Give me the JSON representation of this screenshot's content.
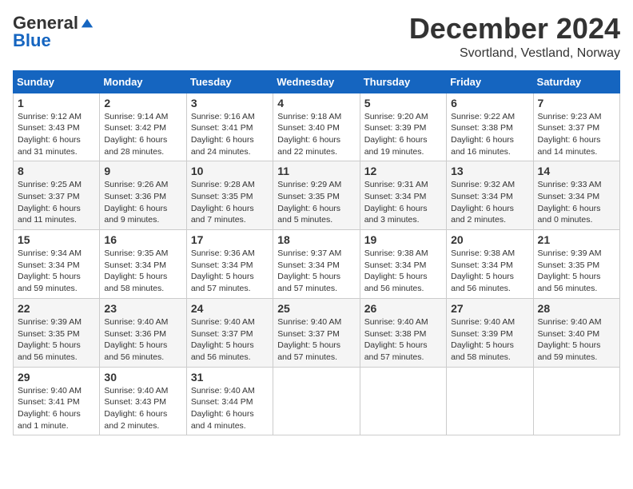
{
  "header": {
    "logo_general": "General",
    "logo_blue": "Blue",
    "month_title": "December 2024",
    "location": "Svortland, Vestland, Norway"
  },
  "days_of_week": [
    "Sunday",
    "Monday",
    "Tuesday",
    "Wednesday",
    "Thursday",
    "Friday",
    "Saturday"
  ],
  "weeks": [
    [
      {
        "day": "1",
        "sunrise": "9:12 AM",
        "sunset": "3:43 PM",
        "daylight": "6 hours and 31 minutes."
      },
      {
        "day": "2",
        "sunrise": "9:14 AM",
        "sunset": "3:42 PM",
        "daylight": "6 hours and 28 minutes."
      },
      {
        "day": "3",
        "sunrise": "9:16 AM",
        "sunset": "3:41 PM",
        "daylight": "6 hours and 24 minutes."
      },
      {
        "day": "4",
        "sunrise": "9:18 AM",
        "sunset": "3:40 PM",
        "daylight": "6 hours and 22 minutes."
      },
      {
        "day": "5",
        "sunrise": "9:20 AM",
        "sunset": "3:39 PM",
        "daylight": "6 hours and 19 minutes."
      },
      {
        "day": "6",
        "sunrise": "9:22 AM",
        "sunset": "3:38 PM",
        "daylight": "6 hours and 16 minutes."
      },
      {
        "day": "7",
        "sunrise": "9:23 AM",
        "sunset": "3:37 PM",
        "daylight": "6 hours and 14 minutes."
      }
    ],
    [
      {
        "day": "8",
        "sunrise": "9:25 AM",
        "sunset": "3:37 PM",
        "daylight": "6 hours and 11 minutes."
      },
      {
        "day": "9",
        "sunrise": "9:26 AM",
        "sunset": "3:36 PM",
        "daylight": "6 hours and 9 minutes."
      },
      {
        "day": "10",
        "sunrise": "9:28 AM",
        "sunset": "3:35 PM",
        "daylight": "6 hours and 7 minutes."
      },
      {
        "day": "11",
        "sunrise": "9:29 AM",
        "sunset": "3:35 PM",
        "daylight": "6 hours and 5 minutes."
      },
      {
        "day": "12",
        "sunrise": "9:31 AM",
        "sunset": "3:34 PM",
        "daylight": "6 hours and 3 minutes."
      },
      {
        "day": "13",
        "sunrise": "9:32 AM",
        "sunset": "3:34 PM",
        "daylight": "6 hours and 2 minutes."
      },
      {
        "day": "14",
        "sunrise": "9:33 AM",
        "sunset": "3:34 PM",
        "daylight": "6 hours and 0 minutes."
      }
    ],
    [
      {
        "day": "15",
        "sunrise": "9:34 AM",
        "sunset": "3:34 PM",
        "daylight": "5 hours and 59 minutes."
      },
      {
        "day": "16",
        "sunrise": "9:35 AM",
        "sunset": "3:34 PM",
        "daylight": "5 hours and 58 minutes."
      },
      {
        "day": "17",
        "sunrise": "9:36 AM",
        "sunset": "3:34 PM",
        "daylight": "5 hours and 57 minutes."
      },
      {
        "day": "18",
        "sunrise": "9:37 AM",
        "sunset": "3:34 PM",
        "daylight": "5 hours and 57 minutes."
      },
      {
        "day": "19",
        "sunrise": "9:38 AM",
        "sunset": "3:34 PM",
        "daylight": "5 hours and 56 minutes."
      },
      {
        "day": "20",
        "sunrise": "9:38 AM",
        "sunset": "3:34 PM",
        "daylight": "5 hours and 56 minutes."
      },
      {
        "day": "21",
        "sunrise": "9:39 AM",
        "sunset": "3:35 PM",
        "daylight": "5 hours and 56 minutes."
      }
    ],
    [
      {
        "day": "22",
        "sunrise": "9:39 AM",
        "sunset": "3:35 PM",
        "daylight": "5 hours and 56 minutes."
      },
      {
        "day": "23",
        "sunrise": "9:40 AM",
        "sunset": "3:36 PM",
        "daylight": "5 hours and 56 minutes."
      },
      {
        "day": "24",
        "sunrise": "9:40 AM",
        "sunset": "3:37 PM",
        "daylight": "5 hours and 56 minutes."
      },
      {
        "day": "25",
        "sunrise": "9:40 AM",
        "sunset": "3:37 PM",
        "daylight": "5 hours and 57 minutes."
      },
      {
        "day": "26",
        "sunrise": "9:40 AM",
        "sunset": "3:38 PM",
        "daylight": "5 hours and 57 minutes."
      },
      {
        "day": "27",
        "sunrise": "9:40 AM",
        "sunset": "3:39 PM",
        "daylight": "5 hours and 58 minutes."
      },
      {
        "day": "28",
        "sunrise": "9:40 AM",
        "sunset": "3:40 PM",
        "daylight": "5 hours and 59 minutes."
      }
    ],
    [
      {
        "day": "29",
        "sunrise": "9:40 AM",
        "sunset": "3:41 PM",
        "daylight": "6 hours and 1 minute."
      },
      {
        "day": "30",
        "sunrise": "9:40 AM",
        "sunset": "3:43 PM",
        "daylight": "6 hours and 2 minutes."
      },
      {
        "day": "31",
        "sunrise": "9:40 AM",
        "sunset": "3:44 PM",
        "daylight": "6 hours and 4 minutes."
      },
      null,
      null,
      null,
      null
    ]
  ],
  "labels": {
    "sunrise": "Sunrise:",
    "sunset": "Sunset:",
    "daylight": "Daylight:"
  }
}
